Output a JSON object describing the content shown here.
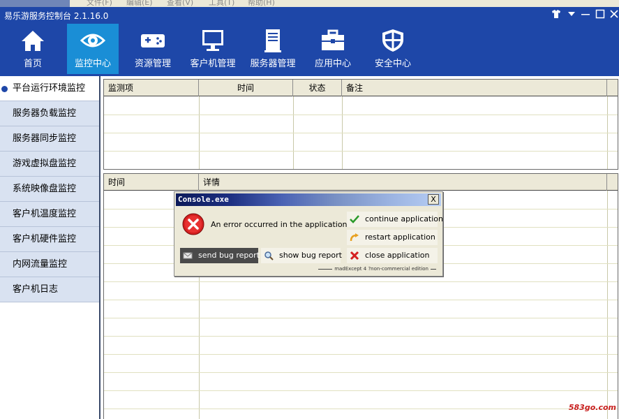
{
  "menu_bar": {
    "items": [
      "文件(F)",
      "编辑(E)",
      "查看(V)",
      "工具(T)",
      "帮助(H)"
    ]
  },
  "app": {
    "title": "易乐游服务控制台 2.1.16.0"
  },
  "toolbar": {
    "items": [
      {
        "label": "首页",
        "icon": "home-icon"
      },
      {
        "label": "监控中心",
        "icon": "eye-icon",
        "active": true
      },
      {
        "label": "资源管理",
        "icon": "gamepad-icon"
      },
      {
        "label": "客户机管理",
        "icon": "monitor-icon"
      },
      {
        "label": "服务器管理",
        "icon": "server-icon"
      },
      {
        "label": "应用中心",
        "icon": "toolbox-icon"
      },
      {
        "label": "安全中心",
        "icon": "shield-icon"
      }
    ]
  },
  "sidebar": {
    "items": [
      {
        "label": "平台运行环境监控",
        "active": true
      },
      {
        "label": "服务器负载监控"
      },
      {
        "label": "服务器同步监控"
      },
      {
        "label": "游戏虚拟盘监控"
      },
      {
        "label": "系统映像盘监控"
      },
      {
        "label": "客户机温度监控"
      },
      {
        "label": "客户机硬件监控"
      },
      {
        "label": "内网流量监控"
      },
      {
        "label": "客户机日志"
      }
    ]
  },
  "monitor_table": {
    "columns": [
      "监测项",
      "时间",
      "状态",
      "备注"
    ]
  },
  "log_table": {
    "columns": [
      "时间",
      "详情"
    ]
  },
  "dialog": {
    "title": "Console.exe",
    "close_label": "X",
    "message": "An error occurred in the application.",
    "buttons": {
      "send_bug_report": "send bug report",
      "show_bug_report": "show bug report",
      "continue_application": "continue application",
      "restart_application": "restart application",
      "close_application": "close application"
    },
    "footer": "madExcept 4 ?non-commercial edition"
  },
  "watermark": "583go.com",
  "colors": {
    "toolbar_blue": "#1e47a8",
    "active_tab": "#1a8ed6",
    "sidebar_bg": "#d9e2f1",
    "header_bg": "#ece9d8"
  }
}
